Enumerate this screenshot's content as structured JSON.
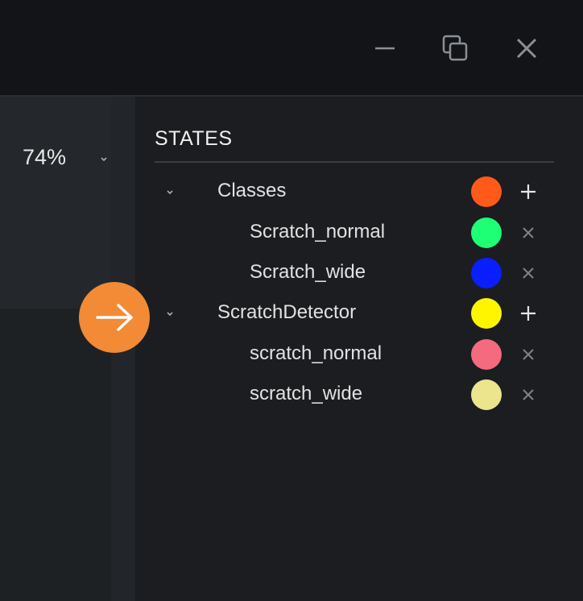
{
  "toolbar": {
    "zoom_value": "74%",
    "icons": [
      "minimize-icon",
      "restore-icon",
      "close-icon",
      "chevron-down-icon"
    ]
  },
  "states": {
    "title": "STATES",
    "groups": [
      {
        "label": "Classes",
        "color": "#ff5a1a",
        "action_icon": "plus-icon",
        "children": [
          {
            "label": "Scratch_normal",
            "color": "#1fff75",
            "action_icon": "x-icon"
          },
          {
            "label": "Scratch_wide",
            "color": "#0a1eff",
            "action_icon": "x-icon"
          }
        ]
      },
      {
        "label": "ScratchDetector",
        "color": "#fff500",
        "action_icon": "plus-icon",
        "children": [
          {
            "label": "scratch_normal",
            "color": "#f46a7e",
            "action_icon": "x-icon"
          },
          {
            "label": "scratch_wide",
            "color": "#ece58e",
            "action_icon": "x-icon"
          }
        ]
      }
    ]
  },
  "pointer": {
    "icon": "arrow-right-icon",
    "color": "#f28a36"
  }
}
